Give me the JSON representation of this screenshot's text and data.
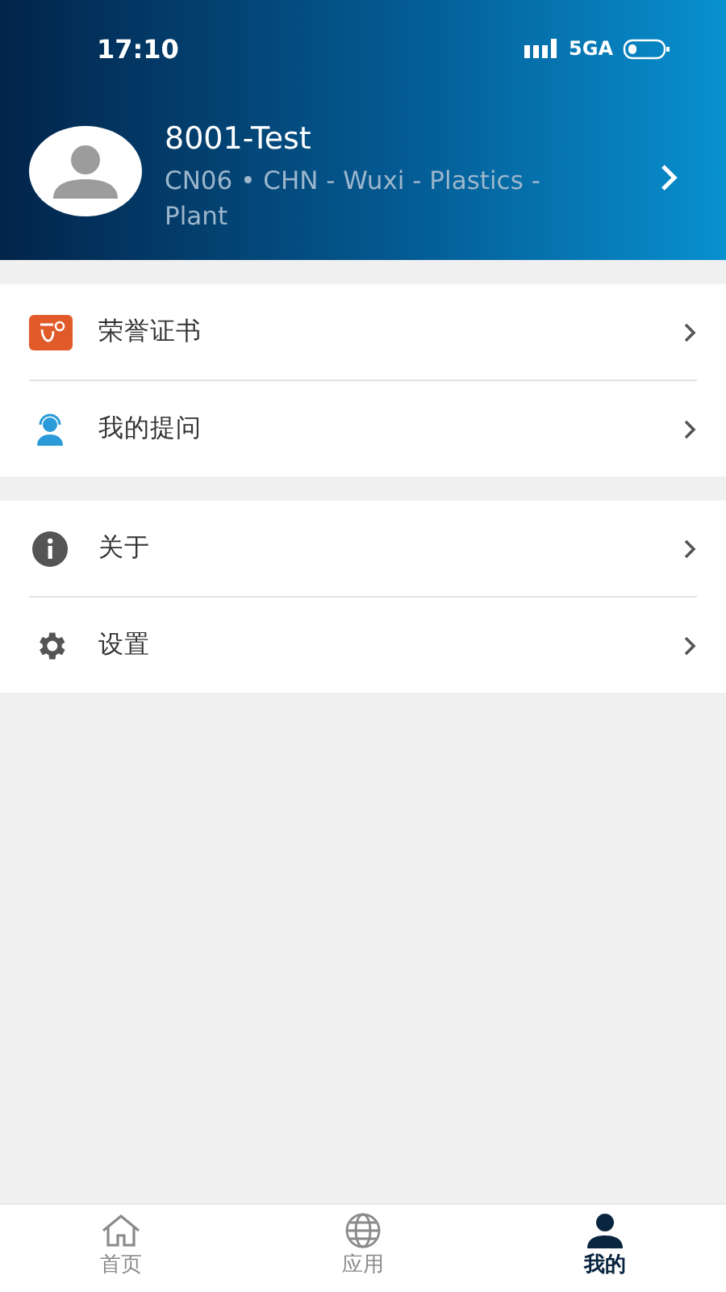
{
  "status_bar": {
    "time": "17:10",
    "network": "5GA"
  },
  "profile": {
    "name": "8001-Test",
    "details": "CN06 • CHN - Wuxi - Plastics - Plant"
  },
  "menu_groups": [
    {
      "items": [
        {
          "kind": "certificate",
          "label": "荣誉证书"
        },
        {
          "kind": "questions",
          "label": "我的提问"
        }
      ]
    },
    {
      "items": [
        {
          "kind": "about",
          "label": "关于"
        },
        {
          "kind": "settings",
          "label": "设置"
        }
      ]
    }
  ],
  "tab_bar": [
    {
      "kind": "home",
      "label": "首页",
      "selected": false
    },
    {
      "kind": "apps",
      "label": "应用",
      "selected": false
    },
    {
      "kind": "profile",
      "label": "我的",
      "selected": true
    }
  ]
}
